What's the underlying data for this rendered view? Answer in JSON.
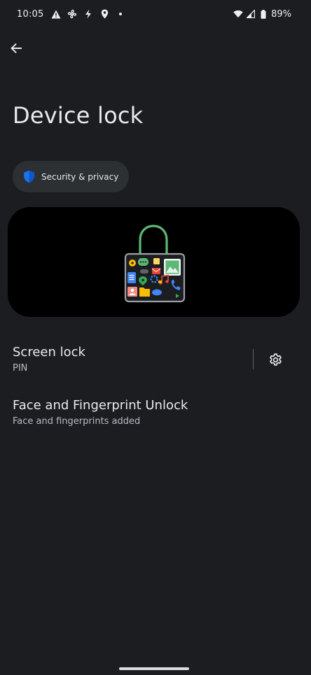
{
  "status_bar": {
    "time": "10:05",
    "battery": "89%",
    "left_icons": [
      "warning-icon",
      "fan-icon",
      "bolt-icon",
      "location-icon",
      "dot-icon"
    ],
    "right_icons": [
      "wifi-icon",
      "signal-icon",
      "battery-icon"
    ]
  },
  "header": {
    "back_icon": "arrow-left-icon",
    "title": "Device lock"
  },
  "breadcrumb": {
    "icon": "shield-icon",
    "label": "Security & privacy"
  },
  "illustration": {
    "name": "lock-with-apps-illustration"
  },
  "settings": [
    {
      "title": "Screen lock",
      "summary": "PIN",
      "action_icon": "gear-icon"
    },
    {
      "title": "Face and Fingerprint Unlock",
      "summary": "Face and fingerprints added"
    }
  ],
  "colors": {
    "background": "#1b1d20",
    "chip_background": "#2d3033",
    "text_primary": "#e8eaed",
    "text_secondary": "#b7bcc2",
    "shield_blue": "#1a73e8",
    "lock_green": "#5bb974"
  }
}
